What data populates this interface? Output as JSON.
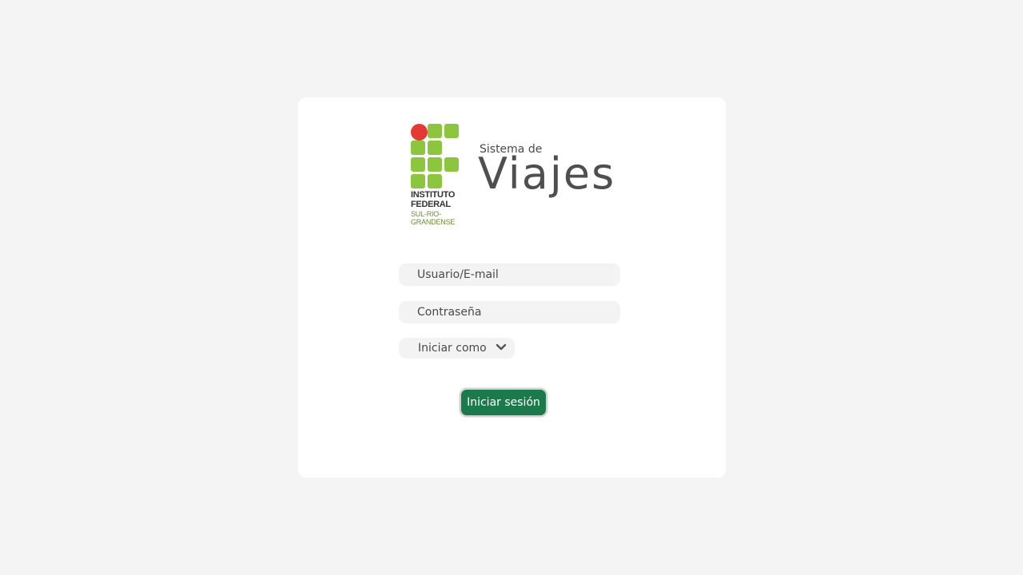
{
  "brand": {
    "logo_line1": "INSTITUTO",
    "logo_line2": "FEDERAL",
    "logo_line3": "SUL-RIO-",
    "logo_line4": "GRANDENSE",
    "title_small": "Sistema de",
    "title_big": "Viajes",
    "colors": {
      "green": "#8cc63f",
      "red": "#e53935"
    }
  },
  "form": {
    "username_placeholder": "Usuario/E-mail",
    "password_placeholder": "Contraseña",
    "role_select_label": "Iniciar como",
    "role_select_icon": "chevron-down-icon",
    "submit_label": "Iniciar sesión",
    "submit_color": "#1a7a4c"
  }
}
